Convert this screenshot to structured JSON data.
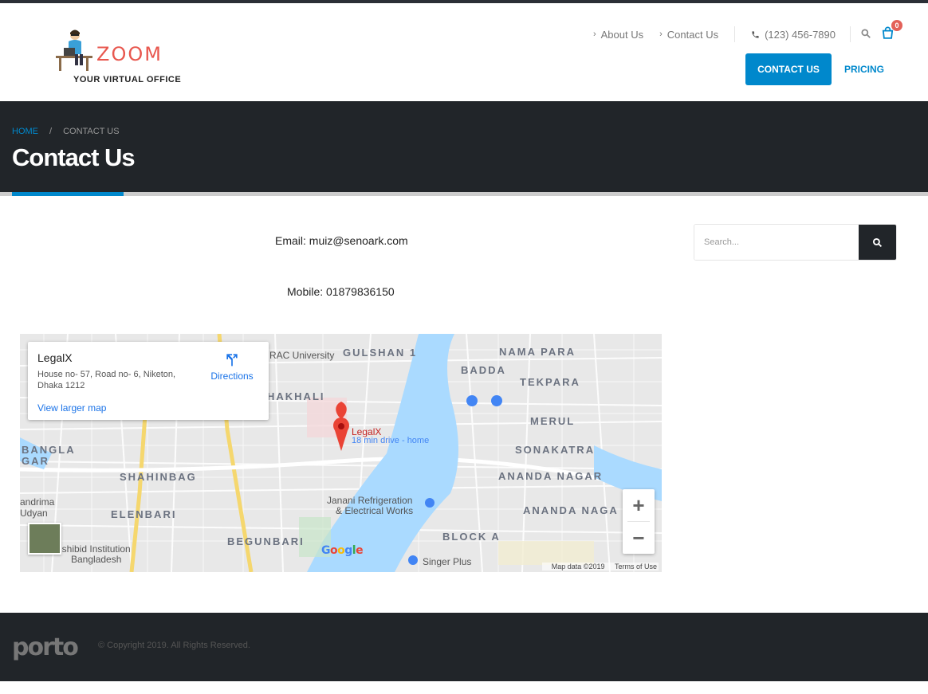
{
  "brand": {
    "name": "ZOOM",
    "tagline": "YOUR VIRTUAL OFFICE"
  },
  "header_nav": {
    "about": "About Us",
    "contact": "Contact Us",
    "phone": "(123) 456-7890",
    "cart_count": "0",
    "contact_button": "CONTACT US",
    "pricing_button": "PRICING"
  },
  "breadcrumb": {
    "home": "HOME",
    "separator": "/",
    "current": "CONTACT US"
  },
  "page": {
    "title": "Contact Us",
    "email": "Email: muiz@senoark.com",
    "mobile": "Mobile: 01879836150"
  },
  "map": {
    "place_name": "LegalX",
    "address": "House no- 57, Road no- 6, Niketon, Dhaka 1212",
    "directions": "Directions",
    "view_larger": "View larger map",
    "pin_label": "LegalX",
    "pin_sublabel": "18 min drive - home",
    "data_credit": "Map data ©2019",
    "terms": "Terms of Use",
    "labels": {
      "gulshan": "GULSHAN 1",
      "nama_para": "NAMA PARA",
      "badda": "BADDA",
      "tekpara": "TEKPARA",
      "merul": "MERUL",
      "sonakatra": "SONAKATRA",
      "ananda_nagar": "ANANDA NAGAR",
      "ananda_naga": "ANANDA NAGA",
      "block_a": "BLOCK A",
      "shahinbag": "SHAHINBAG",
      "elenbari": "ELENBARI",
      "begunbari": "BEGUNBARI",
      "hakhali": "HAKHALI",
      "bangla": "BANGLA",
      "gar": "GAR",
      "brac": "RAC University",
      "janani": "Janani Refrigeration",
      "janani2": "& Electrical Works",
      "singer": "Singer Plus",
      "ishibid": "ishibid Institution",
      "bangladesh": "Bangladesh",
      "andrima": "andrima",
      "udyan": "Udyan"
    }
  },
  "search": {
    "placeholder": "Search..."
  },
  "footer": {
    "logo": "porto",
    "copyright": "© Copyright 2019. All Rights Reserved."
  },
  "colors": {
    "accent": "#0088cc",
    "dark": "#212529",
    "brand_red": "#e8574e",
    "badge": "#e36159"
  }
}
